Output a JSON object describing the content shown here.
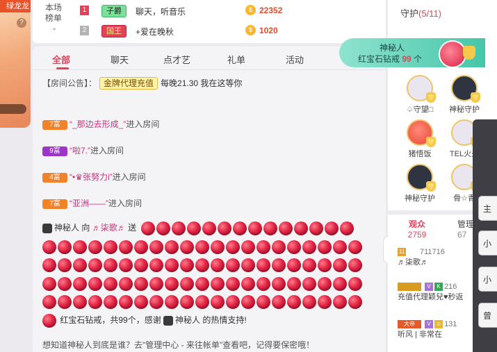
{
  "left_strip": {
    "tag": "绿龙龙",
    "help": "?"
  },
  "ranking": {
    "title": "本场榜单",
    "rows": [
      {
        "rank": "1",
        "badge": "子爵",
        "name": "聊天，听音乐",
        "value": "22352"
      },
      {
        "rank": "2",
        "badge": "国王",
        "name": "+爱在晚秋",
        "value": "1020"
      }
    ]
  },
  "tabs": [
    "全部",
    "聊天",
    "点才艺",
    "礼单",
    "活动"
  ],
  "announcement": {
    "label": "【房间公告】：",
    "button": "金牌代理充值",
    "text": "每晚21.30 我在这等你"
  },
  "entries": [
    {
      "rich": "7富",
      "name": "“_那边去形成_”",
      "action": "进入房间"
    },
    {
      "rich": "9富",
      "name": "“啦7.”",
      "action": "进入房间"
    },
    {
      "rich": "4富",
      "name": "“•♛张努力i”",
      "action": "进入房间"
    },
    {
      "rich": "7富",
      "name": "“亚洲——”",
      "action": "进入房间"
    }
  ],
  "gift": {
    "sender": "神秘人",
    "to": "向",
    "receiver": "♬柒歌♬",
    "verb": "送",
    "summary": "红宝石钻戒，共99个，感谢",
    "thanks_name": "神秘人",
    "thanks_suffix": "的热情支持!",
    "count": 99
  },
  "tip": "想知道神秘人到底是谁？去\"管理中心 - 来往帐单\"查看吧，记得要保密哦！",
  "guard": {
    "title": "守护",
    "count": "(5/11)",
    "items": [
      {
        "name": "♤守望□"
      },
      {
        "name": "神秘守护"
      },
      {
        "name": "猪悟饭"
      },
      {
        "name": "TEL火火"
      },
      {
        "name": "神秘守护"
      },
      {
        "name": "骨☆青"
      }
    ]
  },
  "popup": {
    "name": "神秘人",
    "gift": "红宝石钻戒",
    "count": "99",
    "unit": "个"
  },
  "audience": {
    "tab_label": "观众",
    "tab_count": "2759",
    "mgr_label": "管理",
    "mgr_count": "67",
    "rows": [
      {
        "id": "711716",
        "name": "♬柒歌♬"
      },
      {
        "id": "216",
        "name": "充值代理颖兒♥秒返"
      },
      {
        "id": "131",
        "name": "听风 | 非常在"
      }
    ]
  },
  "dark_strip": {
    "items": [
      "主",
      "小",
      "小",
      "曾"
    ]
  },
  "colors": {
    "accent": "#e5425a",
    "rich7": "#f0822a",
    "rich9": "#9c35c8",
    "rich4": "#f0822a"
  }
}
